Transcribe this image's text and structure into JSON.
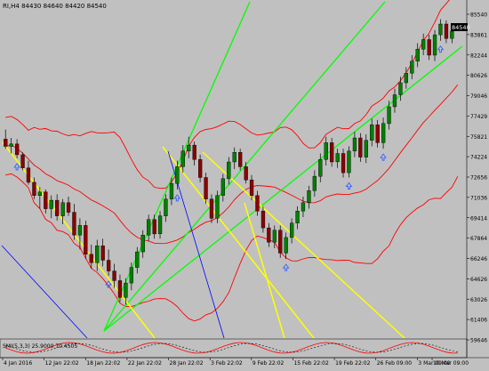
{
  "header": {
    "title": "RI,H4  84430 84640 84420 84540"
  },
  "price_scale": {
    "labels": [
      "85540",
      "83861",
      "82244",
      "80626",
      "79046",
      "77429",
      "75821",
      "74224",
      "72656",
      "71036",
      "69414",
      "67864",
      "66246",
      "64626",
      "63026",
      "61406",
      "59646"
    ],
    "current_price": "84540"
  },
  "indicator": {
    "label": "SMI(5,3,3) 25.9000 70.4505"
  },
  "time_axis": {
    "labels": [
      "4 Jan 2016",
      "12 Jan 22:02",
      "18 Jan 22:02",
      "22 Jan 22:02",
      "28 Jan 22:02",
      "3 Feb 22:02",
      "9 Feb 22:02",
      "15 Feb 22:02",
      "19 Feb 22:02",
      "26 Feb 09:00",
      "3 Mar 09:00",
      "10 Mar 09:00"
    ]
  },
  "colors": {
    "background": "#c0c0c0",
    "bull_candle": "#008000",
    "bear_candle": "#8b0000",
    "bollinger": "#ff0000",
    "fan_lines": "#00ff00",
    "trend_lines": "#ffff00",
    "blue_lines": "#0000ff",
    "arrow": "#3a5fff",
    "axis_text": "#000000",
    "price_tag_bg": "#000000",
    "price_tag_text": "#ffffff"
  },
  "chart_data": {
    "type": "candlestick",
    "ohlc": [
      {
        "o": 75200,
        "h": 76000,
        "l": 74400,
        "c": 74600
      },
      {
        "o": 74600,
        "h": 75300,
        "l": 74000,
        "c": 74800
      },
      {
        "o": 74800,
        "h": 75200,
        "l": 73600,
        "c": 73900
      },
      {
        "o": 73900,
        "h": 74100,
        "l": 72600,
        "c": 72800
      },
      {
        "o": 72800,
        "h": 73400,
        "l": 71400,
        "c": 71600
      },
      {
        "o": 71600,
        "h": 72000,
        "l": 70200,
        "c": 70500
      },
      {
        "o": 70500,
        "h": 71200,
        "l": 69400,
        "c": 70800
      },
      {
        "o": 70800,
        "h": 71000,
        "l": 69000,
        "c": 69400
      },
      {
        "o": 69400,
        "h": 70500,
        "l": 68600,
        "c": 70100
      },
      {
        "o": 70100,
        "h": 70600,
        "l": 68400,
        "c": 68800
      },
      {
        "o": 68800,
        "h": 70200,
        "l": 68100,
        "c": 69900
      },
      {
        "o": 69900,
        "h": 70400,
        "l": 68800,
        "c": 69100
      },
      {
        "o": 69100,
        "h": 69800,
        "l": 66800,
        "c": 67200
      },
      {
        "o": 67200,
        "h": 68600,
        "l": 66000,
        "c": 68000
      },
      {
        "o": 68000,
        "h": 68400,
        "l": 65200,
        "c": 65600
      },
      {
        "o": 65600,
        "h": 66400,
        "l": 64400,
        "c": 64900
      },
      {
        "o": 64900,
        "h": 66800,
        "l": 64200,
        "c": 66300
      },
      {
        "o": 66300,
        "h": 66900,
        "l": 64600,
        "c": 65100
      },
      {
        "o": 65100,
        "h": 66000,
        "l": 63800,
        "c": 64200
      },
      {
        "o": 64200,
        "h": 64800,
        "l": 62800,
        "c": 63400
      },
      {
        "o": 63400,
        "h": 63900,
        "l": 61600,
        "c": 62000
      },
      {
        "o": 62000,
        "h": 63600,
        "l": 61400,
        "c": 63200
      },
      {
        "o": 63200,
        "h": 64900,
        "l": 62600,
        "c": 64500
      },
      {
        "o": 64500,
        "h": 66200,
        "l": 64000,
        "c": 65800
      },
      {
        "o": 65800,
        "h": 67600,
        "l": 65300,
        "c": 67200
      },
      {
        "o": 67200,
        "h": 68900,
        "l": 66700,
        "c": 68500
      },
      {
        "o": 68500,
        "h": 68900,
        "l": 66900,
        "c": 67300
      },
      {
        "o": 67300,
        "h": 69200,
        "l": 66900,
        "c": 68800
      },
      {
        "o": 68800,
        "h": 70600,
        "l": 68300,
        "c": 70200
      },
      {
        "o": 70200,
        "h": 72000,
        "l": 69700,
        "c": 71500
      },
      {
        "o": 71500,
        "h": 73400,
        "l": 71000,
        "c": 72900
      },
      {
        "o": 72900,
        "h": 74700,
        "l": 72400,
        "c": 74200
      },
      {
        "o": 74200,
        "h": 75400,
        "l": 73600,
        "c": 74700
      },
      {
        "o": 74700,
        "h": 75000,
        "l": 73000,
        "c": 73500
      },
      {
        "o": 73500,
        "h": 73900,
        "l": 71600,
        "c": 72000
      },
      {
        "o": 72000,
        "h": 72400,
        "l": 69800,
        "c": 70200
      },
      {
        "o": 70200,
        "h": 70600,
        "l": 68200,
        "c": 68600
      },
      {
        "o": 68600,
        "h": 70900,
        "l": 68200,
        "c": 70500
      },
      {
        "o": 70500,
        "h": 72300,
        "l": 70000,
        "c": 71900
      },
      {
        "o": 71900,
        "h": 73700,
        "l": 71400,
        "c": 73300
      },
      {
        "o": 73300,
        "h": 74500,
        "l": 72700,
        "c": 74100
      },
      {
        "o": 74100,
        "h": 74400,
        "l": 72600,
        "c": 72900
      },
      {
        "o": 72900,
        "h": 73300,
        "l": 71500,
        "c": 71800
      },
      {
        "o": 71800,
        "h": 72200,
        "l": 70100,
        "c": 70500
      },
      {
        "o": 70500,
        "h": 70900,
        "l": 68800,
        "c": 69200
      },
      {
        "o": 69200,
        "h": 69600,
        "l": 67400,
        "c": 67800
      },
      {
        "o": 67800,
        "h": 68200,
        "l": 66200,
        "c": 66600
      },
      {
        "o": 66600,
        "h": 68000,
        "l": 66100,
        "c": 67600
      },
      {
        "o": 67600,
        "h": 68000,
        "l": 65300,
        "c": 65700
      },
      {
        "o": 65700,
        "h": 67400,
        "l": 65200,
        "c": 67000
      },
      {
        "o": 67000,
        "h": 68600,
        "l": 66500,
        "c": 68200
      },
      {
        "o": 68200,
        "h": 69600,
        "l": 67700,
        "c": 69200
      },
      {
        "o": 69200,
        "h": 70400,
        "l": 68700,
        "c": 69900
      },
      {
        "o": 69900,
        "h": 71300,
        "l": 69400,
        "c": 70900
      },
      {
        "o": 70900,
        "h": 72600,
        "l": 70400,
        "c": 72100
      },
      {
        "o": 72100,
        "h": 74000,
        "l": 71600,
        "c": 73500
      },
      {
        "o": 73500,
        "h": 75400,
        "l": 73000,
        "c": 74900
      },
      {
        "o": 74900,
        "h": 75300,
        "l": 72900,
        "c": 73300
      },
      {
        "o": 73300,
        "h": 74400,
        "l": 72800,
        "c": 74000
      },
      {
        "o": 74000,
        "h": 74400,
        "l": 72000,
        "c": 72400
      },
      {
        "o": 72400,
        "h": 74600,
        "l": 72000,
        "c": 74200
      },
      {
        "o": 74200,
        "h": 75800,
        "l": 73700,
        "c": 75300
      },
      {
        "o": 75300,
        "h": 75700,
        "l": 73300,
        "c": 73700
      },
      {
        "o": 73700,
        "h": 75600,
        "l": 73200,
        "c": 75100
      },
      {
        "o": 75100,
        "h": 76900,
        "l": 74600,
        "c": 76400
      },
      {
        "o": 76400,
        "h": 76800,
        "l": 74500,
        "c": 74900
      },
      {
        "o": 74900,
        "h": 77000,
        "l": 74400,
        "c": 76500
      },
      {
        "o": 76500,
        "h": 78400,
        "l": 76000,
        "c": 77900
      },
      {
        "o": 77900,
        "h": 79400,
        "l": 77400,
        "c": 78900
      },
      {
        "o": 78900,
        "h": 80400,
        "l": 78400,
        "c": 79900
      },
      {
        "o": 79900,
        "h": 81200,
        "l": 79400,
        "c": 80700
      },
      {
        "o": 80700,
        "h": 82200,
        "l": 80200,
        "c": 81700
      },
      {
        "o": 81700,
        "h": 83200,
        "l": 81200,
        "c": 82700
      },
      {
        "o": 82700,
        "h": 84000,
        "l": 82200,
        "c": 83500
      },
      {
        "o": 83500,
        "h": 83900,
        "l": 81800,
        "c": 82200
      },
      {
        "o": 82200,
        "h": 84300,
        "l": 81700,
        "c": 83900
      },
      {
        "o": 83900,
        "h": 85200,
        "l": 83400,
        "c": 84800
      },
      {
        "o": 84800,
        "h": 85100,
        "l": 83200,
        "c": 83600
      },
      {
        "o": 83600,
        "h": 84600,
        "l": 83200,
        "c": 84200
      },
      {
        "o": 84430,
        "h": 84640,
        "l": 84420,
        "c": 84540
      }
    ]
  }
}
